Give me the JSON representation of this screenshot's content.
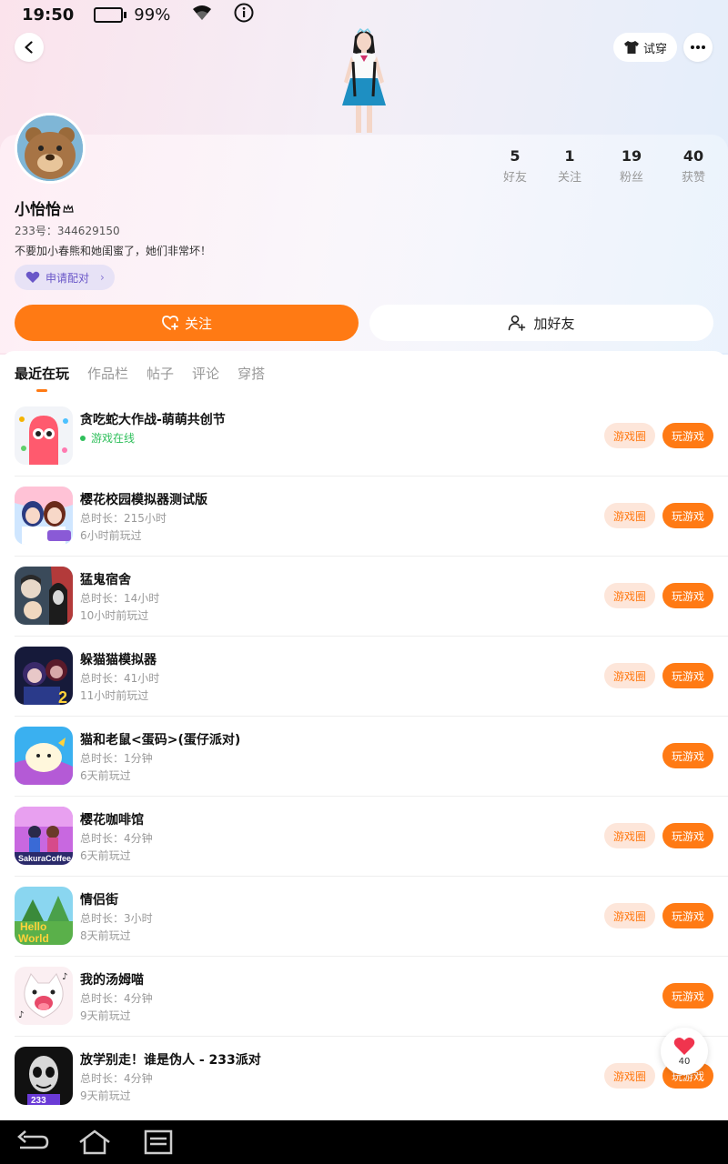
{
  "status_bar": {
    "time": "19:50",
    "battery": "99%",
    "battery_level": 0.99
  },
  "header": {
    "tryon_label": "试穿"
  },
  "profile": {
    "name": "小怡怡",
    "uid": "233号：344629150",
    "bio": "不要加小春熊和她闺蜜了，她们非常坏！",
    "pair_label": "申请配对",
    "stats": [
      {
        "num": "5",
        "label": "好友"
      },
      {
        "num": "1",
        "label": "关注"
      },
      {
        "num": "19",
        "label": "粉丝"
      },
      {
        "num": "40",
        "label": "获赞"
      }
    ],
    "follow_label": "关注",
    "add_friend_label": "加好友"
  },
  "tabs": [
    "最近在玩",
    "作品栏",
    "帖子",
    "评论",
    "穿搭"
  ],
  "games": [
    {
      "title": "贪吃蛇大作战-萌萌共创节",
      "online": "游戏在线",
      "line1": "",
      "line2": "",
      "circle": "游戏圈",
      "play": "玩游戏"
    },
    {
      "title": "樱花校园模拟器测试版",
      "line1": "总时长：215小时",
      "line2": "6小时前玩过",
      "circle": "游戏圈",
      "play": "玩游戏"
    },
    {
      "title": "猛鬼宿舍",
      "line1": "总时长：14小时",
      "line2": "10小时前玩过",
      "circle": "游戏圈",
      "play": "玩游戏"
    },
    {
      "title": "躲猫猫模拟器",
      "line1": "总时长：41小时",
      "line2": "11小时前玩过",
      "circle": "游戏圈",
      "play": "玩游戏"
    },
    {
      "title": "猫和老鼠<蛋码>(蛋仔派对)",
      "line1": "总时长：1分钟",
      "line2": "6天前玩过",
      "circle": "",
      "play": "玩游戏"
    },
    {
      "title": "樱花咖啡馆",
      "line1": "总时长：4分钟",
      "line2": "6天前玩过",
      "circle": "游戏圈",
      "play": "玩游戏"
    },
    {
      "title": "情侣街",
      "line1": "总时长：3小时",
      "line2": "8天前玩过",
      "circle": "游戏圈",
      "play": "玩游戏"
    },
    {
      "title": "我的汤姆喵",
      "line1": "总时长：4分钟",
      "line2": "9天前玩过",
      "circle": "",
      "play": "玩游戏"
    },
    {
      "title": "放学别走！谁是伪人 - 233派对",
      "line1": "总时长：4分钟",
      "line2": "9天前玩过",
      "circle": "游戏圈",
      "play": "玩游戏"
    }
  ],
  "like_fab": {
    "count": "40"
  },
  "colors": {
    "accent": "#ff7a14",
    "online": "#2fbf5b",
    "pair": "#6a57c8"
  }
}
